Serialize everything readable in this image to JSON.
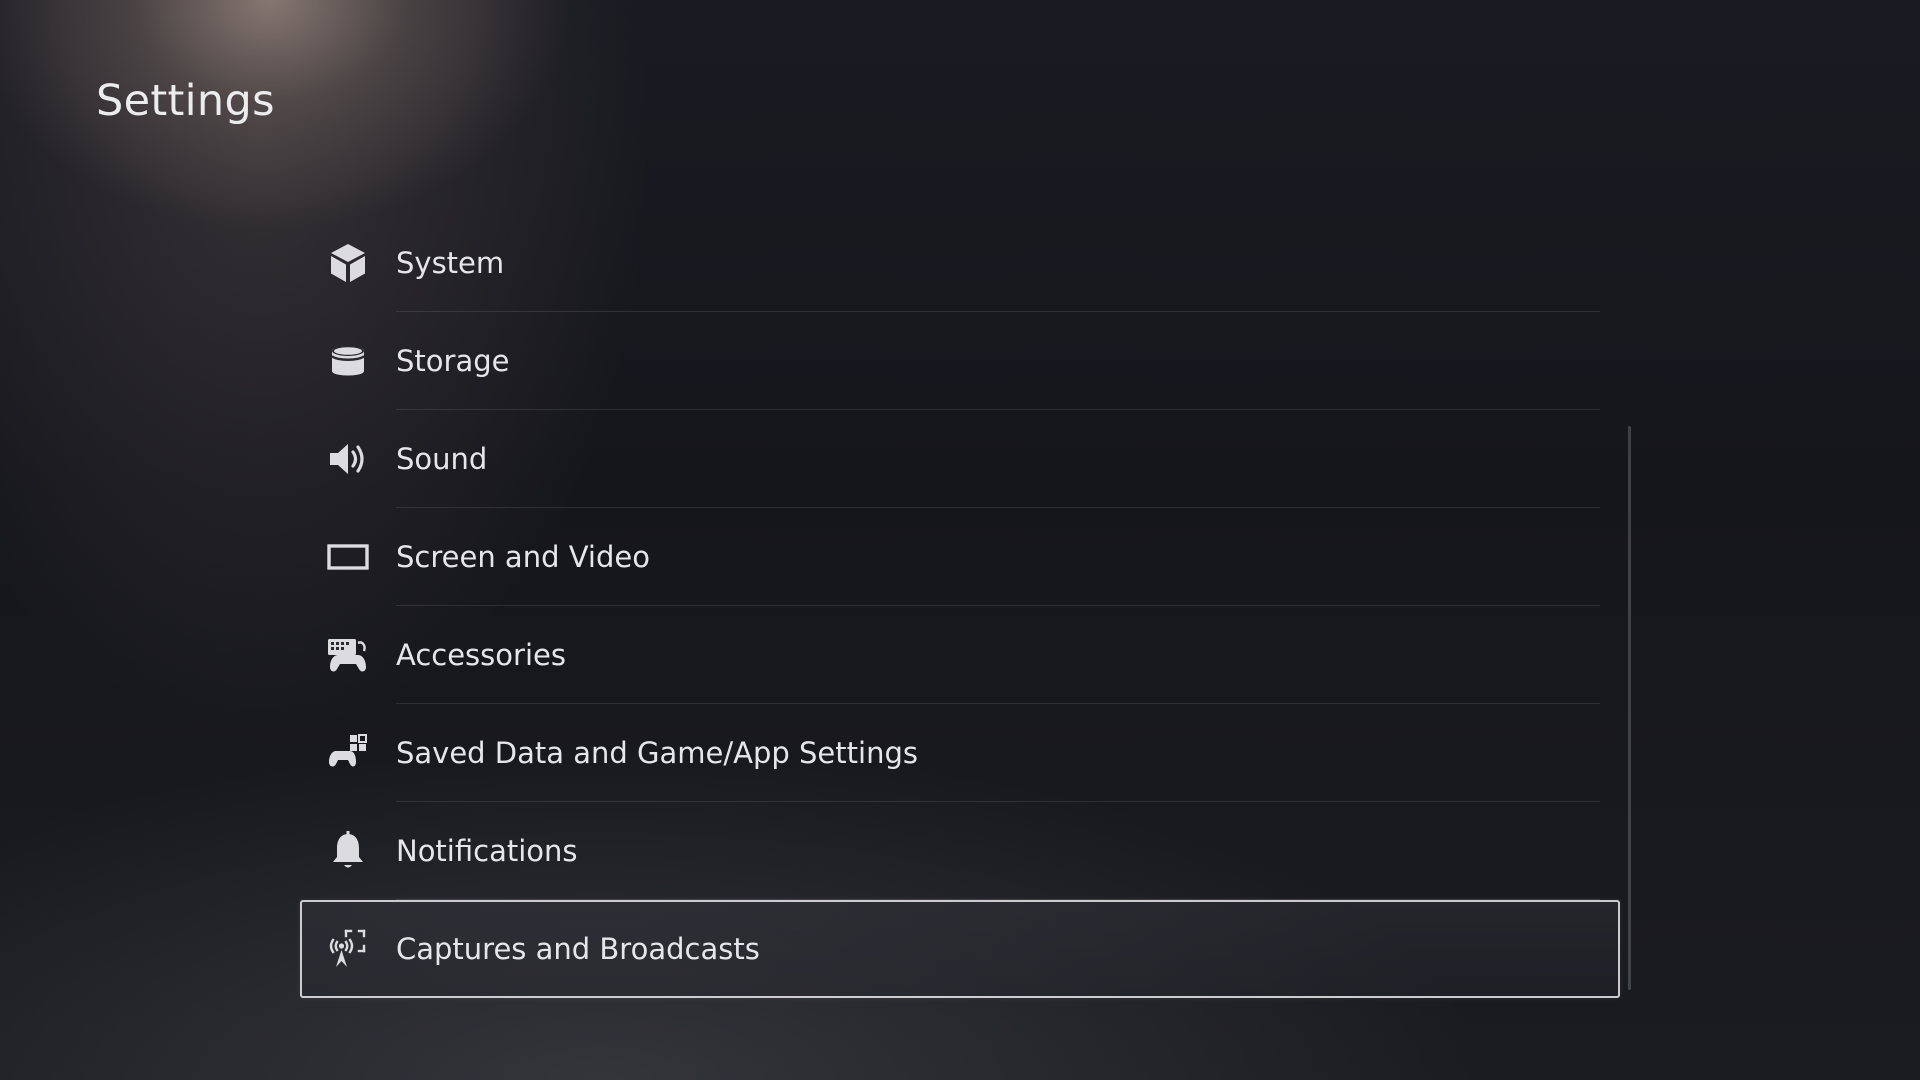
{
  "page": {
    "title": "Settings"
  },
  "menu": {
    "items": [
      {
        "label": "System",
        "icon": "cube-icon"
      },
      {
        "label": "Storage",
        "icon": "database-icon"
      },
      {
        "label": "Sound",
        "icon": "speaker-icon"
      },
      {
        "label": "Screen and Video",
        "icon": "screen-icon"
      },
      {
        "label": "Accessories",
        "icon": "keyboard-controller-icon"
      },
      {
        "label": "Saved Data and Game/App Settings",
        "icon": "controller-apps-icon"
      },
      {
        "label": "Notifications",
        "icon": "bell-icon"
      },
      {
        "label": "Captures and Broadcasts",
        "icon": "capture-broadcast-icon"
      }
    ],
    "selected_index": 7
  },
  "colors": {
    "background": "#15161c",
    "text": "#e6e6ea",
    "selection_border": "#ebe8ec"
  }
}
